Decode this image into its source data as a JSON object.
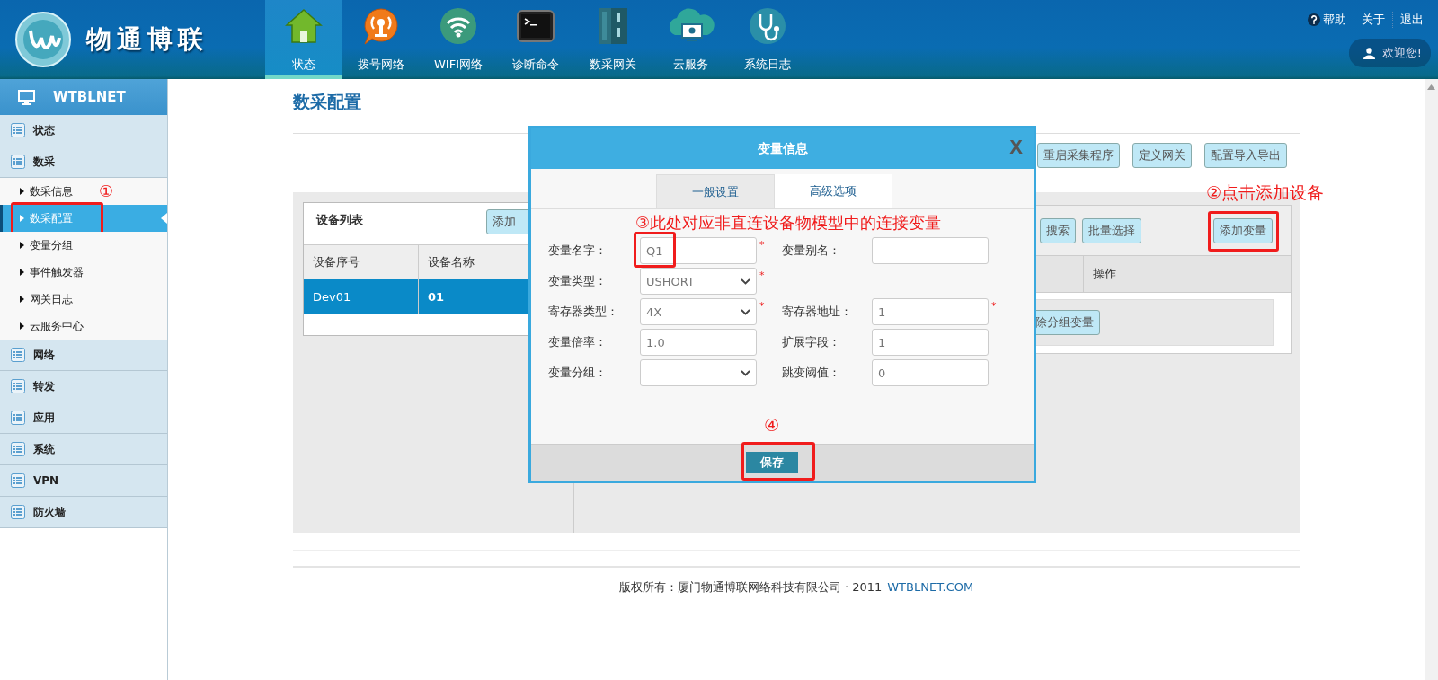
{
  "header": {
    "logo_text": "物通博联",
    "nav": [
      {
        "label": "状态",
        "selected": true
      },
      {
        "label": "拨号网络",
        "selected": false
      },
      {
        "label": "WIFI网络",
        "selected": false
      },
      {
        "label": "诊断命令",
        "selected": false
      },
      {
        "label": "数采网关",
        "selected": false
      },
      {
        "label": "云服务",
        "selected": false
      },
      {
        "label": "系统日志",
        "selected": false
      }
    ],
    "links": [
      "帮助",
      "关于",
      "退出"
    ],
    "welcome": "欢迎您!"
  },
  "sidebar": {
    "title": "WTBLNET",
    "items": [
      {
        "label": "状态"
      },
      {
        "label": "数采",
        "children": [
          {
            "label": "数采信息",
            "selected": false,
            "highlighted": false
          },
          {
            "label": "数采配置",
            "selected": true,
            "highlighted": true,
            "note": "①"
          },
          {
            "label": "变量分组",
            "selected": false,
            "highlighted": false
          },
          {
            "label": "事件触发器",
            "selected": false,
            "highlighted": false
          },
          {
            "label": "网关日志",
            "selected": false,
            "highlighted": false
          },
          {
            "label": "云服务中心",
            "selected": false,
            "highlighted": false
          }
        ]
      },
      {
        "label": "网络"
      },
      {
        "label": "转发"
      },
      {
        "label": "应用"
      },
      {
        "label": "系统"
      },
      {
        "label": "VPN"
      },
      {
        "label": "防火墙"
      }
    ]
  },
  "page": {
    "title": "数采配置",
    "toolbar": [
      "重启采集程序",
      "定义网关",
      "配置导入导出"
    ],
    "device_list": {
      "title": "设备列表",
      "add_button": "添加",
      "columns": [
        "设备序号",
        "设备名称"
      ],
      "rows": [
        {
          "cells": [
            "Dev01",
            "01"
          ],
          "selected": true
        }
      ]
    },
    "variables": {
      "buttons": [
        "搜索",
        "批量选择"
      ],
      "add_button": {
        "label": "添加变量",
        "highlighted": true,
        "note": "②点击添加设备"
      },
      "columns": [
        "操作"
      ],
      "group_button": "除分组变量"
    }
  },
  "dialog": {
    "title": "变量信息",
    "close": "X",
    "tabs": [
      {
        "label": "一般设置",
        "selected": true
      },
      {
        "label": "高级选项",
        "selected": false
      }
    ],
    "note": "③此处对应非直连设备物模型中的连接变量",
    "rows": [
      [
        {
          "label": "变量名字：",
          "kind": "input",
          "value": "Q1",
          "mark": "*",
          "highlighted": true
        },
        {
          "label": "变量别名：",
          "kind": "input"
        }
      ],
      [
        {
          "label": "变量类型：",
          "kind": "select",
          "value": "USHORT",
          "mark": "*"
        }
      ],
      [
        {
          "label": "寄存器类型：",
          "kind": "select",
          "value": "4X",
          "mark": "*"
        },
        {
          "label": "寄存器地址：",
          "kind": "input",
          "value": "1",
          "mark": "*"
        }
      ],
      [
        {
          "label": "变量倍率：",
          "kind": "input",
          "value": "1.0"
        },
        {
          "label": "扩展字段：",
          "kind": "input",
          "value": "1"
        }
      ],
      [
        {
          "label": "变量分组：",
          "kind": "select"
        },
        {
          "label": "跳变阈值：",
          "kind": "input",
          "value": "0"
        }
      ]
    ],
    "save_button": {
      "label": "保存",
      "highlighted": true,
      "note": "④"
    }
  },
  "footer": {
    "text": "版权所有：厦门物通博联网络科技有限公司 · 2011",
    "link": "WTBLNET.COM"
  }
}
